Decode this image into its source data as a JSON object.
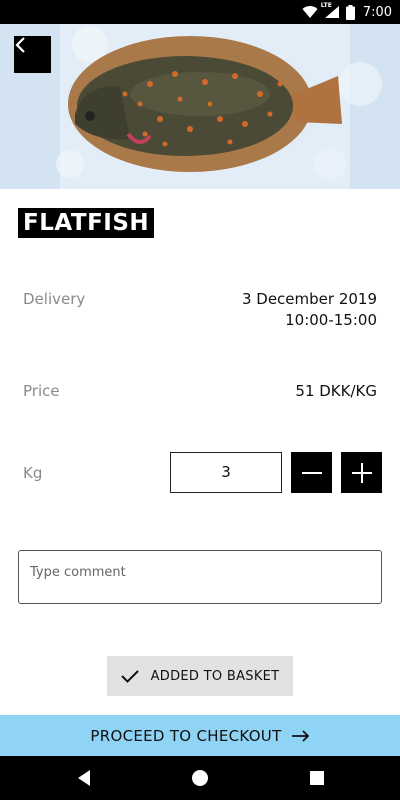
{
  "status_bar": {
    "time": "7:00",
    "icons": [
      "wifi-icon",
      "lte-signal-icon",
      "battery-icon"
    ],
    "network_label": "LTE"
  },
  "header": {
    "back_icon": "chevron-left-icon"
  },
  "product": {
    "title": "FLATFISH",
    "image": "flatfish-on-ice-photo"
  },
  "details": {
    "delivery_label": "Delivery",
    "delivery_date": "3 December 2019",
    "delivery_time": "10:00-15:00",
    "price_label": "Price",
    "price_value": "51 DKK/KG",
    "kg_label": "Kg",
    "kg_value": "3"
  },
  "comment": {
    "placeholder": "Type comment"
  },
  "actions": {
    "added_label": "ADDED TO BASKET",
    "checkout_label": "PROCEED TO CHECKOUT"
  },
  "colors": {
    "accent": "#8fd3f5",
    "button_dark": "#000000",
    "basket_bg": "#e2e2e2"
  }
}
